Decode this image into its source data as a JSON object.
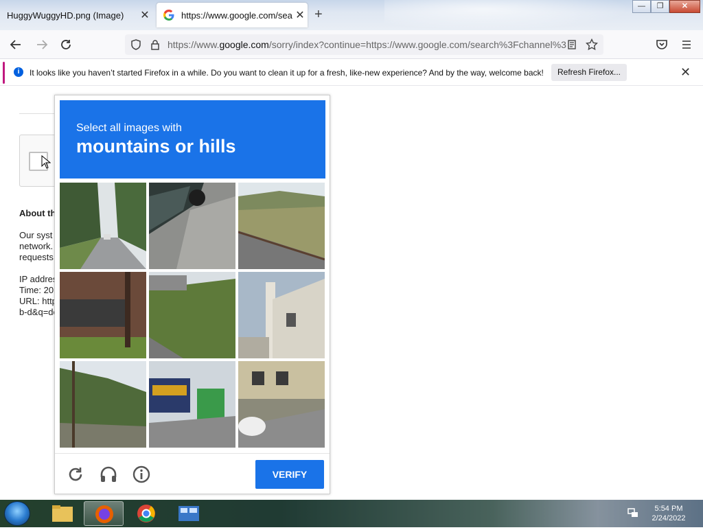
{
  "tabs": [
    {
      "title": "HuggyWuggyHD.png (Image)",
      "close": "✕"
    },
    {
      "title": "https://www.google.com/search",
      "close": "✕"
    }
  ],
  "new_tab": "+",
  "window_buttons": {
    "minimize": "—",
    "restore": "❐",
    "close": "✕"
  },
  "nav": {
    "url_prefix": "https://www.",
    "url_domain": "google.com",
    "url_rest": "/sorry/index?continue=https://www.google.com/search%3Fchannel%3"
  },
  "notification": {
    "text": "It looks like you haven’t started Firefox in a while. Do you want to clean it up for a fresh, like-new experience? And by the way, welcome back!",
    "button": "Refresh Firefox...",
    "close": "✕"
  },
  "page": {
    "about_heading": "About th",
    "lines": [
      "Our syst",
      "network.",
      "requests",
      "",
      "IP addres",
      "Time: 20",
      "URL: http",
      "b-d&q=de"
    ]
  },
  "captcha": {
    "instruction": "Select all images with",
    "target": "mountains or hills",
    "verify": "VERIFY",
    "tiles": [
      "road-with-trees",
      "car-on-pavement",
      "hillside-vineyard",
      "brick-building",
      "grassy-hill-overpass",
      "white-building",
      "hills-with-pole",
      "bus-and-kiosk",
      "building-with-car"
    ]
  },
  "taskbar": {
    "time": "5:54 PM",
    "date": "2/24/2022"
  },
  "colors": {
    "captcha_blue": "#1a73e8",
    "notice_accent": "#c0187f"
  }
}
